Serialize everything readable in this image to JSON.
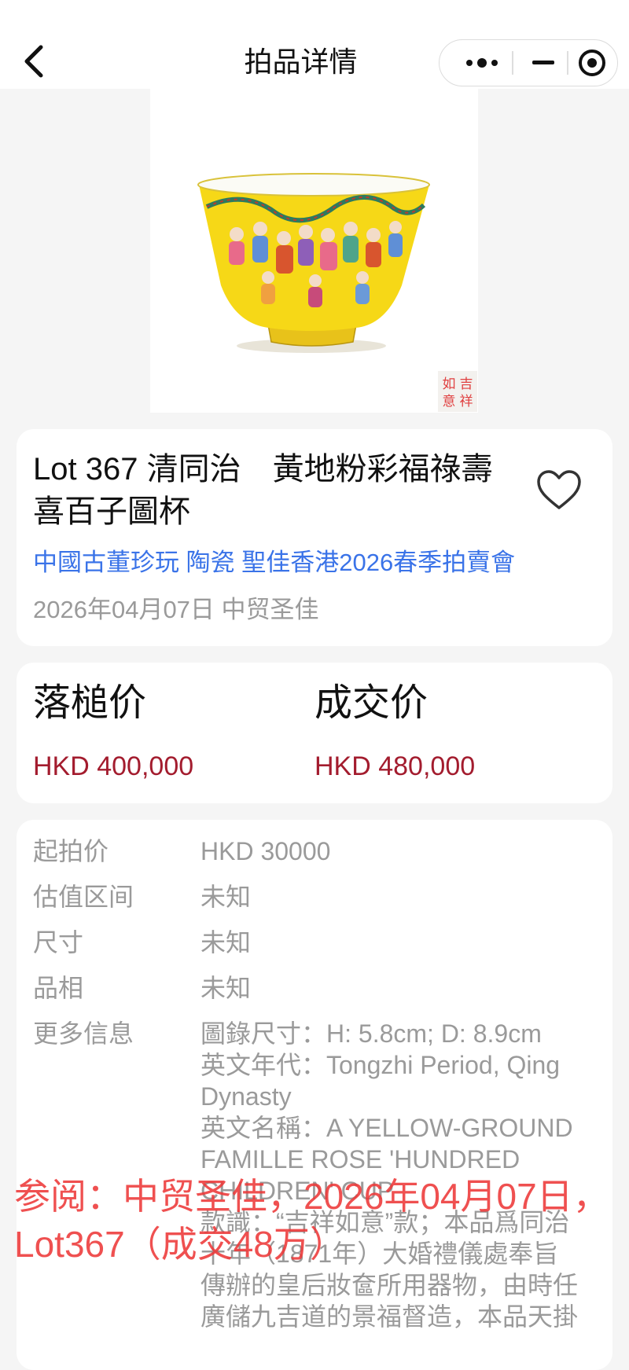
{
  "nav": {
    "title": "拍品详情",
    "back_icon": "chevron-left-icon",
    "capsule": {
      "more_icon": "more-dots-icon",
      "minimize_icon": "minus-icon",
      "close_icon": "target-icon"
    }
  },
  "hero": {
    "image_alt": "yellow-ground famille rose hundred boys cup"
  },
  "lot": {
    "title": "Lot 367 清同治　黃地粉彩福祿壽喜百子圖杯",
    "category": "中國古董珍玩 陶瓷 聖佳香港2026春季拍賣會",
    "date_house": "2026年04月07日 中贸圣佳",
    "favorite_icon": "heart-outline-icon"
  },
  "prices": {
    "hammer_label": "落槌价",
    "hammer_value": "HKD 400,000",
    "deal_label": "成交价",
    "deal_value": "HKD 480,000",
    "value_color": "#a31c2e"
  },
  "details": {
    "rows": [
      {
        "label": "起拍价",
        "value": "HKD 30000"
      },
      {
        "label": "估值区间",
        "value": "未知"
      },
      {
        "label": "尺寸",
        "value": "未知"
      },
      {
        "label": "品相",
        "value": "未知"
      }
    ],
    "more_label": "更多信息",
    "more_lines": [
      "圖錄尺寸：H: 5.8cm; D: 8.9cm",
      "英文年代：Tongzhi Period, Qing",
      "Dynasty",
      "英文名稱：A YELLOW-GROUND",
      "FAMILLE ROSE 'HUNDRED",
      "CHILDREN' CUP",
      "款識：“吉祥如意”款；本品爲同治",
      "十年（1871年）大婚禮儀處奉旨",
      "傳辦的皇后妝奩所用器物，由時任",
      "廣儲九吉道的景福督造，本品天掛"
    ]
  },
  "overlay": {
    "text": "参阅：中贸圣佳，2026年04月07日，Lot367（成交48万）",
    "color": "#ed3838"
  },
  "seal_text": [
    "吉",
    "祥",
    "如",
    "意"
  ]
}
